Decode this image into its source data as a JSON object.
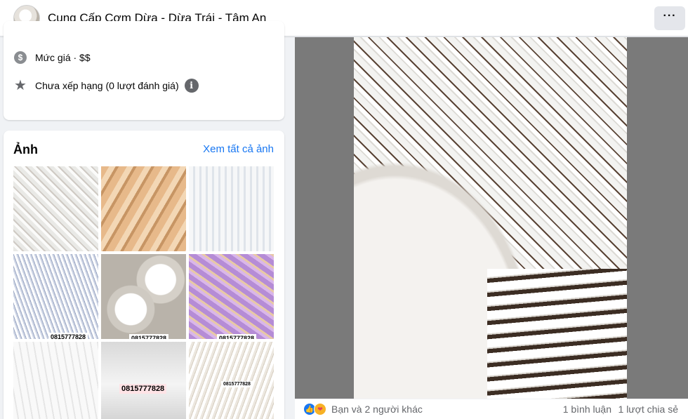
{
  "header": {
    "page_title": "Cung Cấp Cơm Dừa - Dừa Trái - Tâm An",
    "more_label": "···"
  },
  "info": {
    "price_label": "Mức giá · $$",
    "rating_label": "Chưa xếp hạng (0 lượt đánh giá)",
    "info_icon_glyph": "i",
    "dollar_icon_glyph": "$",
    "star_icon_glyph": "★"
  },
  "photos": {
    "title": "Ảnh",
    "see_all": "Xem tất cả ảnh",
    "phone_labels": [
      "0815777828",
      "0815777828",
      "0815777828",
      "0815777828",
      "0815777828"
    ]
  },
  "post_footer": {
    "reaction_text": "Bạn và 2 người khác",
    "comments": "1 bình luận",
    "shares": "1 lượt chia sẻ",
    "like_glyph": "👍",
    "care_glyph": "❤"
  },
  "colors": {
    "accent": "#1877f2",
    "secondary_text": "#65676b",
    "background": "#f0f2f5"
  }
}
